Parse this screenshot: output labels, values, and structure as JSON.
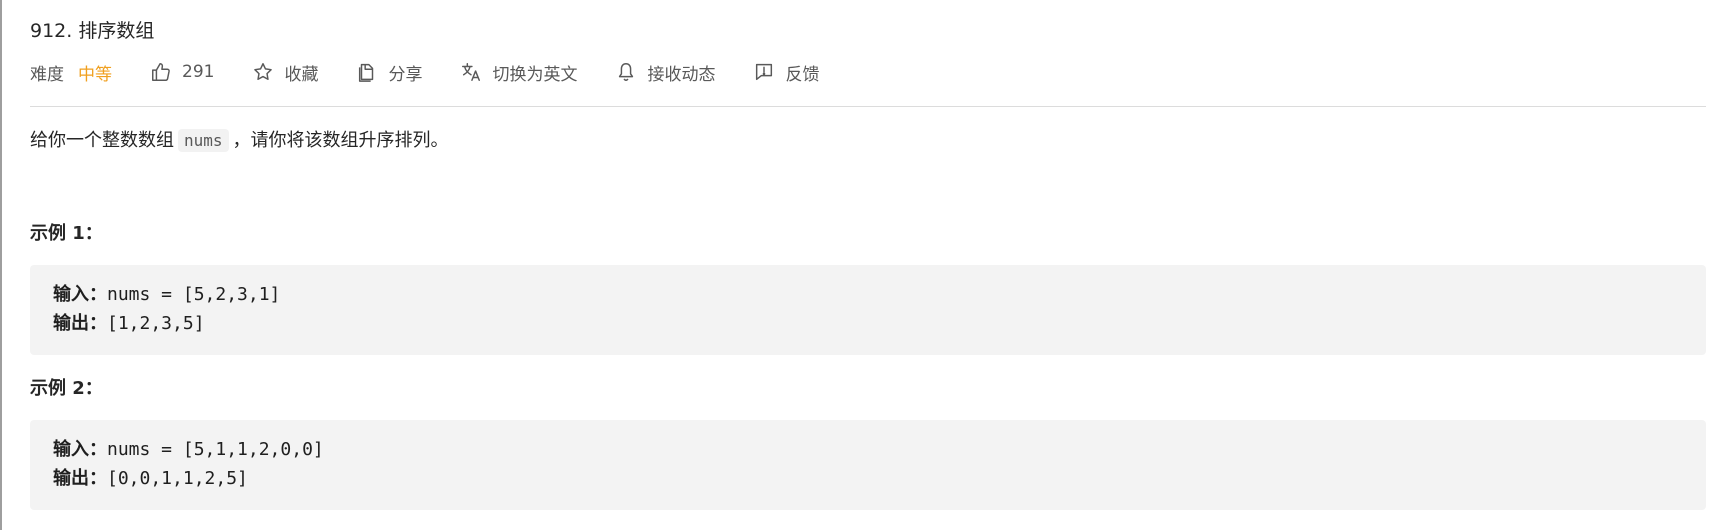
{
  "problem": {
    "title": "912. 排序数组",
    "difficulty_label": "难度",
    "difficulty_value": "中等",
    "likes": "291",
    "favorite_label": "收藏",
    "share_label": "分享",
    "switch_lang_label": "切换为英文",
    "subscribe_label": "接收动态",
    "feedback_label": "反馈"
  },
  "description": {
    "prefix": "给你一个整数数组",
    "code": "nums",
    "suffix": "，请你将该数组升序排列。"
  },
  "examples": [
    {
      "title": "示例 1：",
      "input_label": "输入：",
      "input_value": "nums = [5,2,3,1]",
      "output_label": "输出：",
      "output_value": "[1,2,3,5]"
    },
    {
      "title": "示例 2：",
      "input_label": "输入：",
      "input_value": "nums = [5,1,1,2,0,0]",
      "output_label": "输出：",
      "output_value": "[0,0,1,1,2,5]"
    }
  ],
  "icons": {
    "like": "thumbs-up-icon",
    "favorite": "star-icon",
    "share": "share-icon",
    "translate": "translate-icon",
    "subscribe": "bell-icon",
    "feedback": "feedback-icon"
  },
  "colors": {
    "difficulty_medium": "#f0a020",
    "code_background": "#f3f3f3"
  }
}
